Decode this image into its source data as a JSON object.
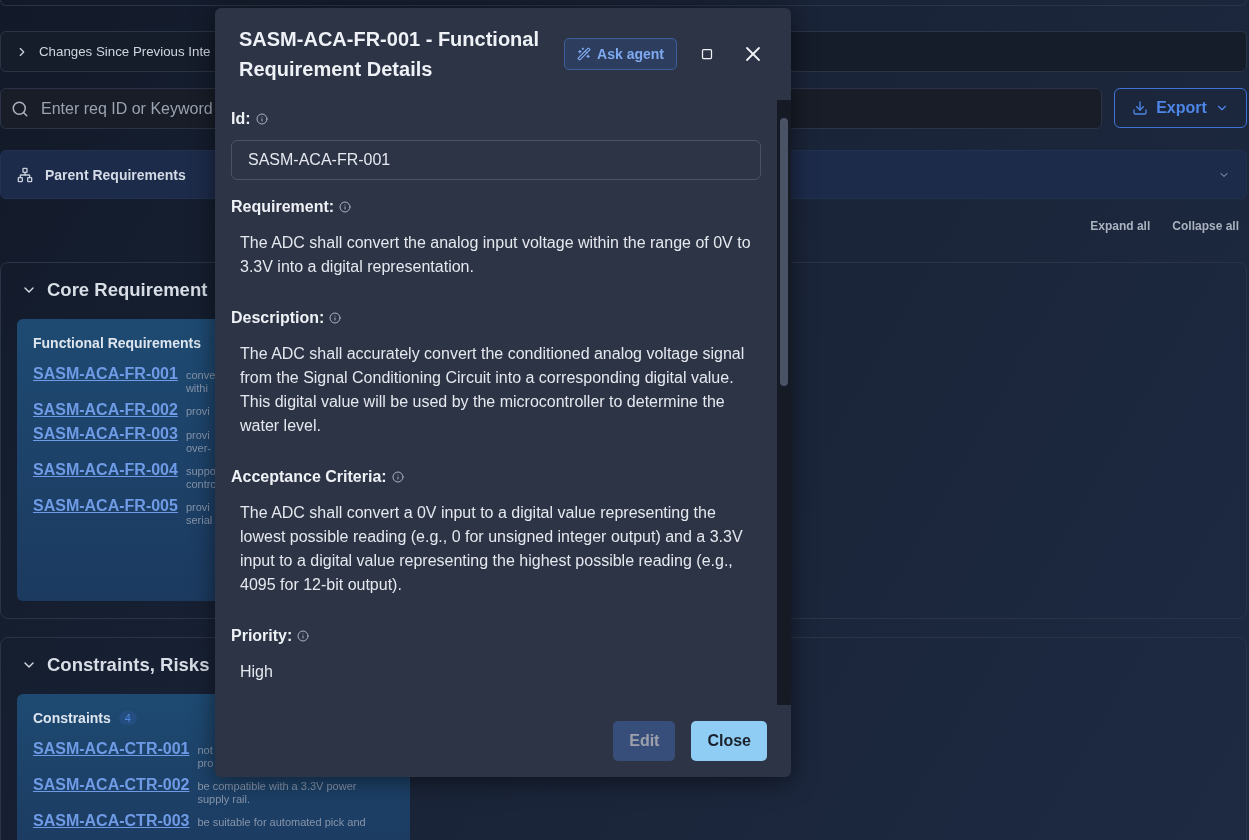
{
  "changes_bar": {
    "label": "Changes Since Previous Inte",
    "expanded": false
  },
  "search": {
    "placeholder": "Enter req ID or Keyword"
  },
  "export_button": {
    "label": "Export"
  },
  "parent_panel": {
    "label": "Parent Requirements"
  },
  "tree_actions": [
    "Expand all",
    "Collapse all"
  ],
  "sections": [
    {
      "title": "Core Requirement",
      "expanded": true,
      "groups": [
        {
          "title": "Functional Requirements",
          "rows": [
            {
              "id": "SASM-ACA-FR-001",
              "text": [
                "conve",
                "withi"
              ]
            },
            {
              "id": "SASM-ACA-FR-002",
              "text": [
                "provi"
              ]
            },
            {
              "id": "SASM-ACA-FR-003",
              "text": [
                "provi",
                "over-"
              ]
            },
            {
              "id": "SASM-ACA-FR-004",
              "text": [
                "suppo",
                "contro"
              ]
            },
            {
              "id": "SASM-ACA-FR-005",
              "text": [
                "provi",
                "serial"
              ]
            }
          ]
        }
      ]
    },
    {
      "title": "Constraints, Risks",
      "expanded": true,
      "groups": [
        {
          "title": "Constraints",
          "count": "4",
          "rows": [
            {
              "id": "SASM-ACA-CTR-001",
              "text": [
                "not",
                "pro"
              ]
            },
            {
              "id": "SASM-ACA-CTR-002",
              "text": [
                "be compatible with a 3.3V power",
                "supply rail."
              ]
            },
            {
              "id": "SASM-ACA-CTR-003",
              "text": [
                "be suitable for automated pick and"
              ]
            }
          ]
        }
      ]
    }
  ],
  "dialog": {
    "title": "SASM-ACA-FR-001 - Functional Requirement Details",
    "agent_button": "Ask agent",
    "fields": [
      {
        "kind": "input",
        "label": "Id:",
        "value": "SASM-ACA-FR-001"
      },
      {
        "kind": "text",
        "label": "Requirement:",
        "value": "The ADC shall convert the analog input voltage within the range of 0V to 3.3V into a digital representation."
      },
      {
        "kind": "text",
        "label": "Description:",
        "value": "The ADC shall accurately convert the conditioned analog voltage signal from the Signal Conditioning Circuit into a corresponding digital value. This digital value will be used by the microcontroller to determine the water level."
      },
      {
        "kind": "text",
        "label": "Acceptance Criteria:",
        "value": "The ADC shall convert a 0V input to a digital value representing the lowest possible reading (e.g., 0 for unsigned integer output) and a 3.3V input to a digital value representing the highest possible reading (e.g., 4095 for 12-bit output)."
      },
      {
        "kind": "text",
        "label": "Priority:",
        "value": "High"
      }
    ],
    "buttons": [
      {
        "label": "Edit",
        "kind": "secondary",
        "disabled": true
      },
      {
        "label": "Close",
        "kind": "primary",
        "disabled": false
      }
    ]
  }
}
